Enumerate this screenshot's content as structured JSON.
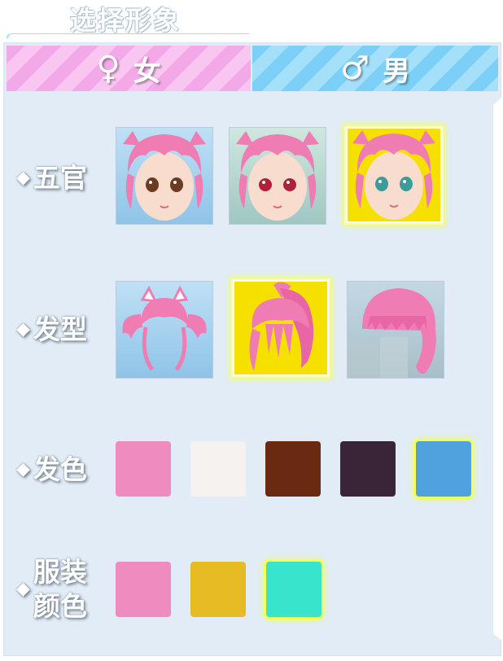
{
  "title": "选择形象",
  "tabs": {
    "female": {
      "icon": "♀",
      "label": "女",
      "active": true
    },
    "male": {
      "icon": "♂",
      "label": "男",
      "active": false
    }
  },
  "rows": {
    "features": {
      "label": "五官"
    },
    "hairstyle": {
      "label": "发型"
    },
    "hair_color": {
      "label": "发色"
    },
    "outfit_color": {
      "label_line1": "服装",
      "label_line2": "颜色"
    }
  },
  "feature_options": [
    {
      "icon": "face-brown-eyes-icon",
      "selected": false
    },
    {
      "icon": "face-red-eyes-icon",
      "selected": false
    },
    {
      "icon": "face-teal-eyes-icon",
      "selected": true
    }
  ],
  "hairstyle_options": [
    {
      "icon": "twin-tails-cat-ears-icon",
      "selected": false
    },
    {
      "icon": "high-ponytail-icon",
      "selected": true
    },
    {
      "icon": "bob-cut-icon",
      "selected": false
    }
  ],
  "hair_colors": [
    {
      "color": "#f08bbf",
      "selected": false
    },
    {
      "color": "#f5f2f0",
      "selected": false
    },
    {
      "color": "#6a2a12",
      "selected": false
    },
    {
      "color": "#3a2538",
      "selected": false
    },
    {
      "color": "#4fa2dd",
      "selected": true
    }
  ],
  "outfit_colors": [
    {
      "color": "#f08bbf",
      "selected": false
    },
    {
      "color": "#e6bb24",
      "selected": false
    },
    {
      "color": "#38e4cc",
      "selected": true
    }
  ]
}
